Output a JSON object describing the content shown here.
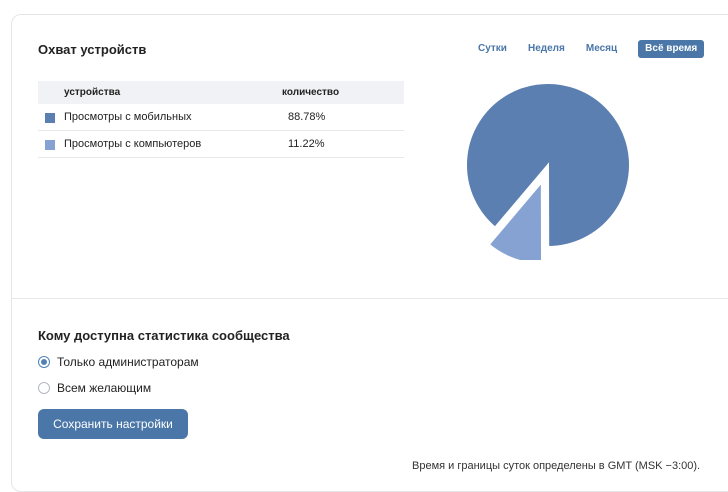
{
  "devices_section": {
    "title": "Охват устройств",
    "tabs": [
      {
        "label": "Сутки",
        "active": false
      },
      {
        "label": "Неделя",
        "active": false
      },
      {
        "label": "Месяц",
        "active": false
      },
      {
        "label": "Всё время",
        "active": true
      }
    ],
    "table": {
      "headers": [
        "устройства",
        "количество"
      ],
      "rows": [
        {
          "label": "Просмотры с мобильных",
          "value": "88.78%",
          "color": "#5b7fb0"
        },
        {
          "label": "Просмотры с компьютеров",
          "value": "11.22%",
          "color": "#86a2d3"
        }
      ]
    }
  },
  "chart_data": {
    "type": "pie",
    "categories": [
      "Просмотры с мобильных",
      "Просмотры с компьютеров"
    ],
    "values": [
      88.78,
      11.22
    ],
    "colors": [
      "#5b7fb0",
      "#86a2d3"
    ],
    "exploded": [
      false,
      true
    ]
  },
  "access_section": {
    "title": "Кому доступна статистика сообщества",
    "options": [
      {
        "label": "Только администраторам",
        "checked": true
      },
      {
        "label": "Всем желающим",
        "checked": false
      }
    ],
    "save_label": "Сохранить настройки"
  },
  "footnote": "Время и границы суток определены в GMT (MSK −3:00)."
}
